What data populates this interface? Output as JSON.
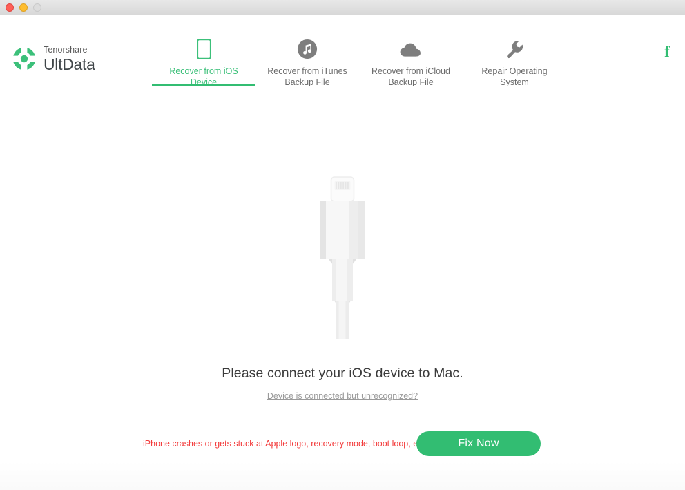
{
  "window": {
    "traffic_lights": [
      {
        "name": "close",
        "color": "#ff5f57"
      },
      {
        "name": "minimize",
        "color": "#ffbd2e"
      },
      {
        "name": "zoom",
        "color": "#dddddd"
      }
    ]
  },
  "brand": {
    "company": "Tenorshare",
    "product": "UltData",
    "logo_icon": "tenorshare-ring-logo-icon",
    "accent_color": "#32bd72"
  },
  "nav": {
    "items": [
      {
        "label": "Recover from iOS Device",
        "line1": "Recover from iOS",
        "line2": "Device",
        "icon": "iphone-icon",
        "active": true
      },
      {
        "label": "Recover from iTunes Backup File",
        "line1": "Recover from iTunes",
        "line2": "Backup File",
        "icon": "itunes-music-note-icon",
        "active": false
      },
      {
        "label": "Recover from iCloud Backup File",
        "line1": "Recover from iCloud",
        "line2": "Backup File",
        "icon": "icloud-cloud-icon",
        "active": false
      },
      {
        "label": "Repair Operating System",
        "line1": "Repair Operating",
        "line2": "System",
        "icon": "wrench-icon",
        "active": false
      }
    ],
    "social": {
      "icon": "facebook-icon",
      "glyph": "f",
      "color": "#32bd72"
    }
  },
  "main": {
    "illustration": "lightning-cable-illustration",
    "headline": "Please connect your iOS device to Mac.",
    "help_link": "Device is connected but unrecognized?"
  },
  "bottom": {
    "crash_note": "iPhone crashes or gets stuck at Apple logo, recovery mode, boot loop, etc?",
    "crash_note_color": "#f33b3b",
    "fix_button_label": "Fix Now",
    "fix_button_color": "#32bd72"
  }
}
